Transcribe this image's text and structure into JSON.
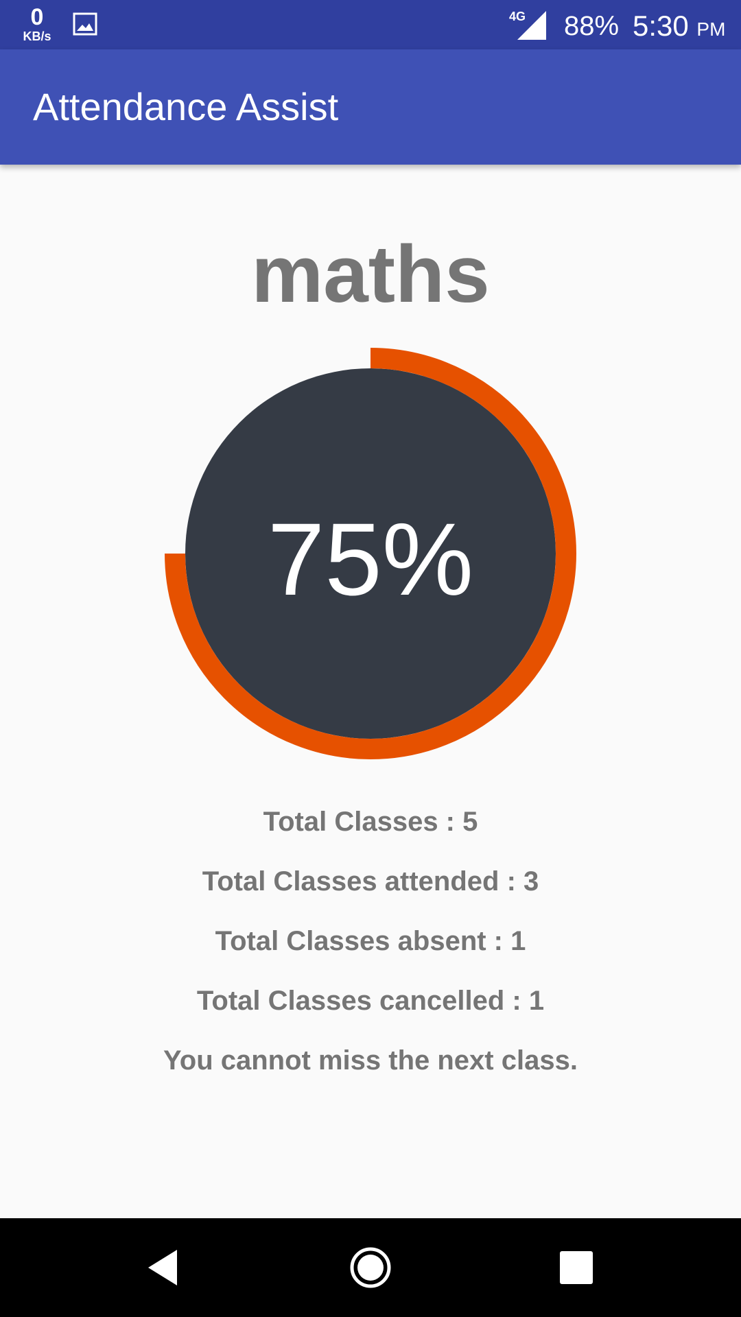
{
  "status_bar": {
    "net_speed_value": "0",
    "net_speed_unit": "KB/s",
    "notification_icon": "image-icon",
    "network_type": "4G",
    "battery": "88%",
    "time": "5:30",
    "ampm": "PM"
  },
  "app_bar": {
    "title": "Attendance Assist"
  },
  "subject": {
    "name": "maths",
    "attendance_percent": "75%",
    "attendance_fraction": 0.75,
    "ring_color": "#e65100",
    "circle_color": "#353b45"
  },
  "stats": [
    "Total Classes : 5",
    "Total Classes attended : 3",
    "Total Classes absent : 1",
    "Total Classes cancelled : 1",
    "You cannot miss the next class."
  ],
  "nav_bar": {
    "back_icon": "back-icon",
    "home_icon": "home-icon",
    "recents_icon": "recents-icon"
  }
}
